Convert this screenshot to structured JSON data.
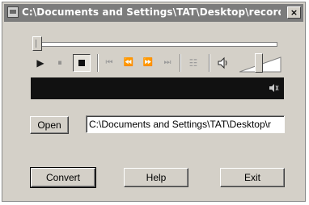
{
  "window": {
    "title": "C:\\Documents and Settings\\TAT\\Desktop\\record f...",
    "close_label": "×"
  },
  "transport": {
    "play_icon": "play-icon",
    "pause_icon": "pause-icon",
    "stop_icon": "stop-icon",
    "skip_back_icon": "skip-to-start-icon",
    "rewind_icon": "rewind-icon",
    "fast_forward_icon": "fast-forward-icon",
    "skip_forward_icon": "skip-to-end-icon",
    "playlist_icon": "playlist-icon",
    "speaker_icon": "speaker-icon",
    "play_glyph": "▶",
    "pause_glyph": "⏸",
    "skip_back_glyph": "⏮",
    "rewind_glyph": "⏪",
    "ff_glyph": "⏩",
    "skip_forward_glyph": "⏭",
    "playlist_glyph": "☷"
  },
  "seek": {
    "position": 0.0
  },
  "volume": {
    "level": 0.45
  },
  "file": {
    "open_label": "Open",
    "path_value": "C:\\Documents and Settings\\TAT\\Desktop\\r"
  },
  "actions": {
    "convert_label": "Convert",
    "help_label": "Help",
    "exit_label": "Exit"
  },
  "colors": {
    "face": "#d4d0c8",
    "titlebar": "#7c7c7c",
    "display": "#111111"
  }
}
